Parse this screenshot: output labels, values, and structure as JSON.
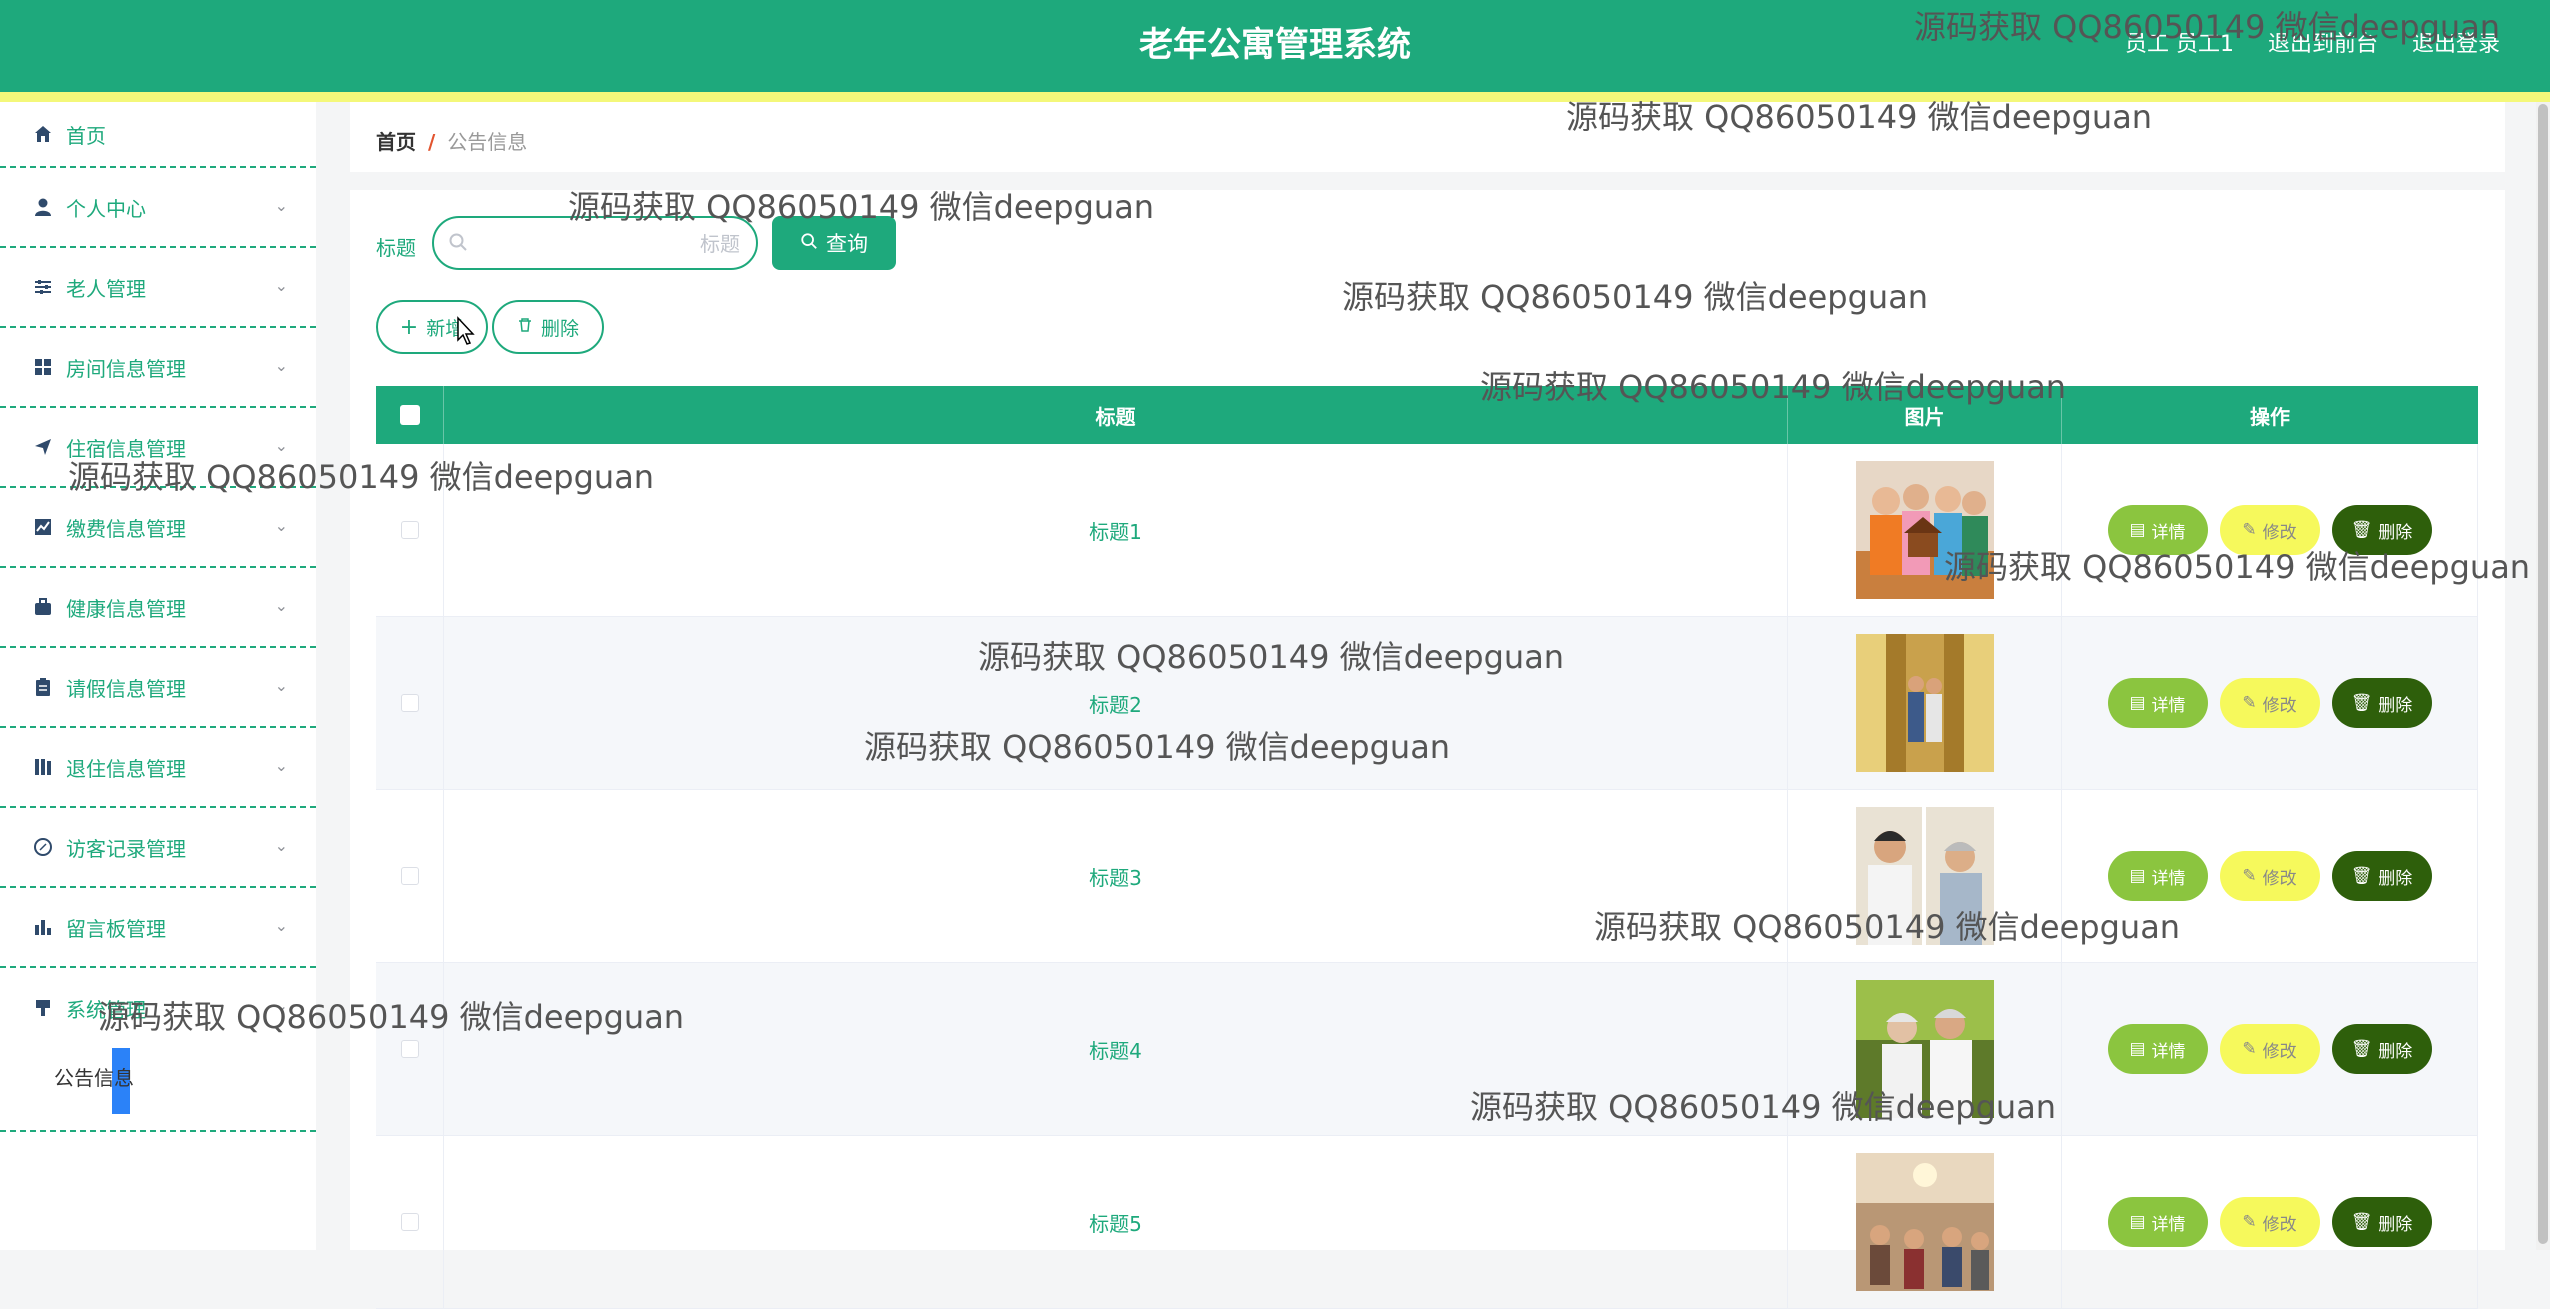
{
  "header": {
    "title": "老年公寓管理系统",
    "user_label": "员工 员工1",
    "front_link": "退出到前台",
    "logout_link": "退出登录"
  },
  "sidebar": {
    "items": [
      {
        "label": "首页",
        "icon": "home-icon"
      },
      {
        "label": "个人中心",
        "icon": "user-icon"
      },
      {
        "label": "老人管理",
        "icon": "sliders-icon"
      },
      {
        "label": "房间信息管理",
        "icon": "grid-icon"
      },
      {
        "label": "住宿信息管理",
        "icon": "send-icon"
      },
      {
        "label": "缴费信息管理",
        "icon": "chart-icon"
      },
      {
        "label": "健康信息管理",
        "icon": "briefcase-icon"
      },
      {
        "label": "请假信息管理",
        "icon": "clipboard-icon"
      },
      {
        "label": "退住信息管理",
        "icon": "books-icon"
      },
      {
        "label": "访客记录管理",
        "icon": "compass-icon"
      },
      {
        "label": "留言板管理",
        "icon": "bar-chart-icon"
      },
      {
        "label": "系统管理",
        "icon": "brush-icon"
      }
    ],
    "sub_item": "公告信息"
  },
  "breadcrumb": {
    "home": "首页",
    "separator": "/",
    "current": "公告信息"
  },
  "search": {
    "label": "标题",
    "placeholder": "标题",
    "button": "查询"
  },
  "actions": {
    "add": "新增",
    "delete": "删除"
  },
  "table": {
    "columns": [
      "标题",
      "图片",
      "操作"
    ],
    "rows": [
      {
        "title": "标题1"
      },
      {
        "title": "标题2"
      },
      {
        "title": "标题3"
      },
      {
        "title": "标题4"
      },
      {
        "title": "标题5"
      }
    ],
    "ops": {
      "detail": "详情",
      "edit": "修改",
      "delete": "删除"
    }
  },
  "watermark": "源码获取 QQ86050149 微信deepguan",
  "colors": {
    "primary": "#1ea97c",
    "accent_line": "#f4f87a",
    "detail_btn": "#8bc53f",
    "edit_btn": "#f6f95c",
    "delete_btn": "#2e5f0b"
  }
}
